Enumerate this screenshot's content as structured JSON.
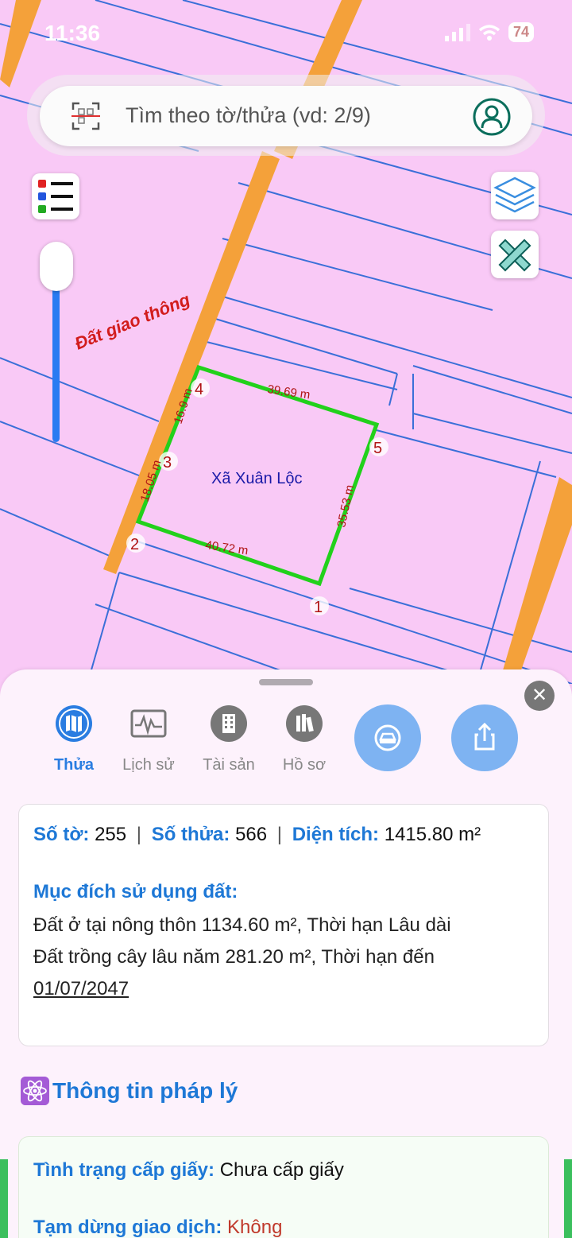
{
  "status": {
    "time": "11:36",
    "battery": "74"
  },
  "search": {
    "placeholder": "Tìm theo tờ/thửa (vd: 2/9)"
  },
  "map": {
    "road_label": "Đất giao thông",
    "parcel_name": "Xã Xuân Lộc",
    "vertices": [
      "1",
      "2",
      "3",
      "4",
      "5"
    ],
    "edges": [
      "39.69 m",
      "35.53 m",
      "40.72 m",
      "18.05 m",
      "16.9 m"
    ]
  },
  "tabs": [
    {
      "label": "Thửa",
      "icon": "map-icon",
      "active": true
    },
    {
      "label": "Lịch sử",
      "icon": "history-chart-icon",
      "active": false
    },
    {
      "label": "Tài sản",
      "icon": "building-icon",
      "active": false
    },
    {
      "label": "Hồ sơ",
      "icon": "books-icon",
      "active": false
    }
  ],
  "parcel": {
    "sheet_label": "Số tờ:",
    "sheet_value": "255",
    "lot_label": "Số thửa:",
    "lot_value": "566",
    "area_label": "Diện tích:",
    "area_value": "1415.80 m²",
    "separator": "|",
    "purpose_title": "Mục đích sử dụng đất:",
    "purpose_lines": [
      "Đất ở tại nông thôn 1134.60 m², Thời hạn Lâu dài",
      "Đất trồng cây lâu năm 281.20 m², Thời hạn đến",
      "01/07/2047"
    ]
  },
  "legal": {
    "title": "Thông tin pháp lý",
    "certificate_label": "Tình trạng cấp giấy:",
    "certificate_value": "Chưa cấp giấy",
    "suspend_label": "Tạm dừng giao dịch:",
    "suspend_value": "Không"
  },
  "colors": {
    "map_bg": "#f9c9f6",
    "road": "#f4a13a",
    "parcel_outline": "#22d11b",
    "accent": "#1e78d6"
  }
}
